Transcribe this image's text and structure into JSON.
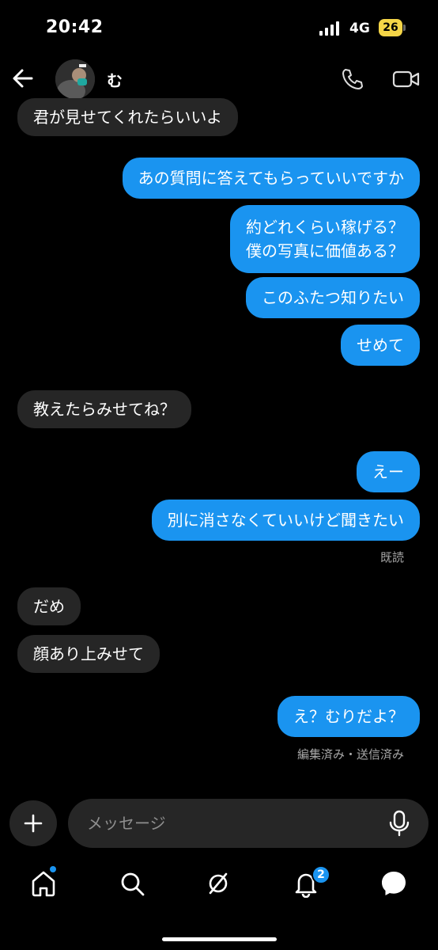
{
  "status": {
    "time": "20:42",
    "network": "4G",
    "battery": "26"
  },
  "header": {
    "contact_name": "む",
    "icons": [
      "back-arrow-icon",
      "phone-icon",
      "video-icon"
    ]
  },
  "messages": {
    "m1": "君が見せてくれたらいいよ",
    "m2": "あの質問に答えてもらっていいですか",
    "m3_line1": "約どれくらい稼げる？",
    "m3_line2": "僕の写真に価値ある？",
    "m4": "このふたつ知りたい",
    "m5": "せめて",
    "m6": "教えたらみせてね？",
    "m7": "えー",
    "m8": "別に消さなくていいけど聞きたい",
    "read_receipt": "既読",
    "m9": "だめ",
    "m10": "顔あり上みせて",
    "m11": "え？むりだよ？",
    "edit_status": "編集済み・送信済み"
  },
  "composer": {
    "placeholder": "メッセージ"
  },
  "nav": {
    "icons": [
      "home-icon",
      "search-icon",
      "explore-icon",
      "bell-icon",
      "messenger-icon"
    ],
    "notification_count": "2"
  },
  "colors": {
    "outgoing": "#1a94f0",
    "incoming": "#262626",
    "background": "#000000"
  }
}
